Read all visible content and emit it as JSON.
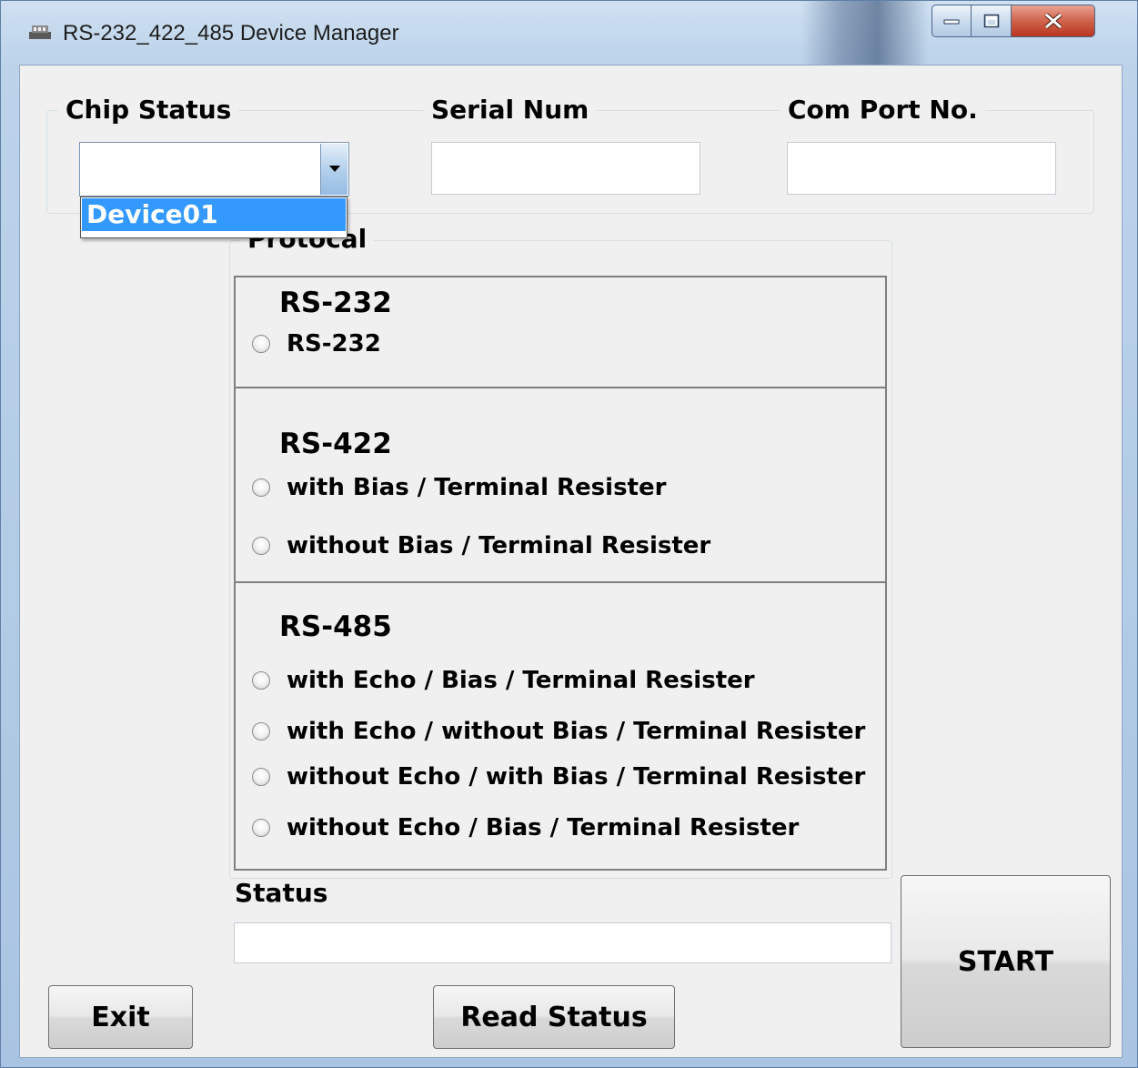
{
  "window": {
    "title": "RS-232_422_485 Device Manager",
    "controls": {
      "minimize": "minimize",
      "maximize": "maximize",
      "close": "close"
    }
  },
  "chip_status": {
    "label": "Chip Status",
    "value": "",
    "dropdown_items": [
      "Device01"
    ],
    "selected_item": "Device01"
  },
  "serial_num": {
    "label": "Serial Num",
    "value": ""
  },
  "com_port": {
    "label": "Com Port No.",
    "value": ""
  },
  "protocol": {
    "label": "Protocal",
    "sections": [
      {
        "title": "RS-232",
        "options": [
          "RS-232"
        ]
      },
      {
        "title": "RS-422",
        "options": [
          "with Bias / Terminal Resister",
          "without Bias / Terminal Resister"
        ]
      },
      {
        "title": "RS-485",
        "options": [
          "with Echo / Bias / Terminal Resister",
          "with Echo / without Bias / Terminal Resister",
          "without Echo / with Bias / Terminal Resister",
          "without Echo / Bias / Terminal Resister"
        ]
      }
    ]
  },
  "status": {
    "label": "Status",
    "value": ""
  },
  "buttons": {
    "exit": "Exit",
    "read_status": "Read Status",
    "start": "START"
  },
  "colors": {
    "selection": "#3399ff",
    "close_button": "#c8452d",
    "form_background": "#f0f0f0"
  }
}
